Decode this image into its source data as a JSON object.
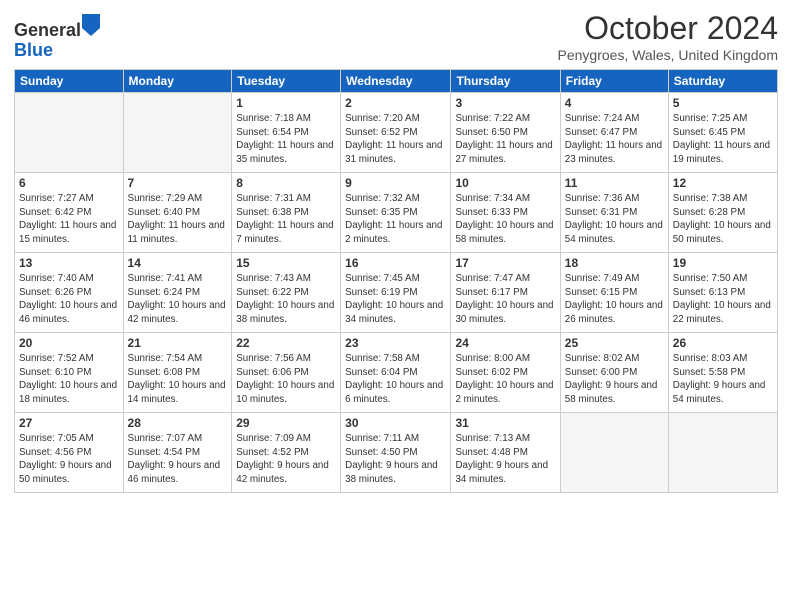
{
  "logo": {
    "general": "General",
    "blue": "Blue"
  },
  "title": "October 2024",
  "subtitle": "Penygroes, Wales, United Kingdom",
  "days_of_week": [
    "Sunday",
    "Monday",
    "Tuesday",
    "Wednesday",
    "Thursday",
    "Friday",
    "Saturday"
  ],
  "weeks": [
    [
      {
        "day": "",
        "info": ""
      },
      {
        "day": "",
        "info": ""
      },
      {
        "day": "1",
        "info": "Sunrise: 7:18 AM\nSunset: 6:54 PM\nDaylight: 11 hours and 35 minutes."
      },
      {
        "day": "2",
        "info": "Sunrise: 7:20 AM\nSunset: 6:52 PM\nDaylight: 11 hours and 31 minutes."
      },
      {
        "day": "3",
        "info": "Sunrise: 7:22 AM\nSunset: 6:50 PM\nDaylight: 11 hours and 27 minutes."
      },
      {
        "day": "4",
        "info": "Sunrise: 7:24 AM\nSunset: 6:47 PM\nDaylight: 11 hours and 23 minutes."
      },
      {
        "day": "5",
        "info": "Sunrise: 7:25 AM\nSunset: 6:45 PM\nDaylight: 11 hours and 19 minutes."
      }
    ],
    [
      {
        "day": "6",
        "info": "Sunrise: 7:27 AM\nSunset: 6:42 PM\nDaylight: 11 hours and 15 minutes."
      },
      {
        "day": "7",
        "info": "Sunrise: 7:29 AM\nSunset: 6:40 PM\nDaylight: 11 hours and 11 minutes."
      },
      {
        "day": "8",
        "info": "Sunrise: 7:31 AM\nSunset: 6:38 PM\nDaylight: 11 hours and 7 minutes."
      },
      {
        "day": "9",
        "info": "Sunrise: 7:32 AM\nSunset: 6:35 PM\nDaylight: 11 hours and 2 minutes."
      },
      {
        "day": "10",
        "info": "Sunrise: 7:34 AM\nSunset: 6:33 PM\nDaylight: 10 hours and 58 minutes."
      },
      {
        "day": "11",
        "info": "Sunrise: 7:36 AM\nSunset: 6:31 PM\nDaylight: 10 hours and 54 minutes."
      },
      {
        "day": "12",
        "info": "Sunrise: 7:38 AM\nSunset: 6:28 PM\nDaylight: 10 hours and 50 minutes."
      }
    ],
    [
      {
        "day": "13",
        "info": "Sunrise: 7:40 AM\nSunset: 6:26 PM\nDaylight: 10 hours and 46 minutes."
      },
      {
        "day": "14",
        "info": "Sunrise: 7:41 AM\nSunset: 6:24 PM\nDaylight: 10 hours and 42 minutes."
      },
      {
        "day": "15",
        "info": "Sunrise: 7:43 AM\nSunset: 6:22 PM\nDaylight: 10 hours and 38 minutes."
      },
      {
        "day": "16",
        "info": "Sunrise: 7:45 AM\nSunset: 6:19 PM\nDaylight: 10 hours and 34 minutes."
      },
      {
        "day": "17",
        "info": "Sunrise: 7:47 AM\nSunset: 6:17 PM\nDaylight: 10 hours and 30 minutes."
      },
      {
        "day": "18",
        "info": "Sunrise: 7:49 AM\nSunset: 6:15 PM\nDaylight: 10 hours and 26 minutes."
      },
      {
        "day": "19",
        "info": "Sunrise: 7:50 AM\nSunset: 6:13 PM\nDaylight: 10 hours and 22 minutes."
      }
    ],
    [
      {
        "day": "20",
        "info": "Sunrise: 7:52 AM\nSunset: 6:10 PM\nDaylight: 10 hours and 18 minutes."
      },
      {
        "day": "21",
        "info": "Sunrise: 7:54 AM\nSunset: 6:08 PM\nDaylight: 10 hours and 14 minutes."
      },
      {
        "day": "22",
        "info": "Sunrise: 7:56 AM\nSunset: 6:06 PM\nDaylight: 10 hours and 10 minutes."
      },
      {
        "day": "23",
        "info": "Sunrise: 7:58 AM\nSunset: 6:04 PM\nDaylight: 10 hours and 6 minutes."
      },
      {
        "day": "24",
        "info": "Sunrise: 8:00 AM\nSunset: 6:02 PM\nDaylight: 10 hours and 2 minutes."
      },
      {
        "day": "25",
        "info": "Sunrise: 8:02 AM\nSunset: 6:00 PM\nDaylight: 9 hours and 58 minutes."
      },
      {
        "day": "26",
        "info": "Sunrise: 8:03 AM\nSunset: 5:58 PM\nDaylight: 9 hours and 54 minutes."
      }
    ],
    [
      {
        "day": "27",
        "info": "Sunrise: 7:05 AM\nSunset: 4:56 PM\nDaylight: 9 hours and 50 minutes."
      },
      {
        "day": "28",
        "info": "Sunrise: 7:07 AM\nSunset: 4:54 PM\nDaylight: 9 hours and 46 minutes."
      },
      {
        "day": "29",
        "info": "Sunrise: 7:09 AM\nSunset: 4:52 PM\nDaylight: 9 hours and 42 minutes."
      },
      {
        "day": "30",
        "info": "Sunrise: 7:11 AM\nSunset: 4:50 PM\nDaylight: 9 hours and 38 minutes."
      },
      {
        "day": "31",
        "info": "Sunrise: 7:13 AM\nSunset: 4:48 PM\nDaylight: 9 hours and 34 minutes."
      },
      {
        "day": "",
        "info": ""
      },
      {
        "day": "",
        "info": ""
      }
    ]
  ]
}
